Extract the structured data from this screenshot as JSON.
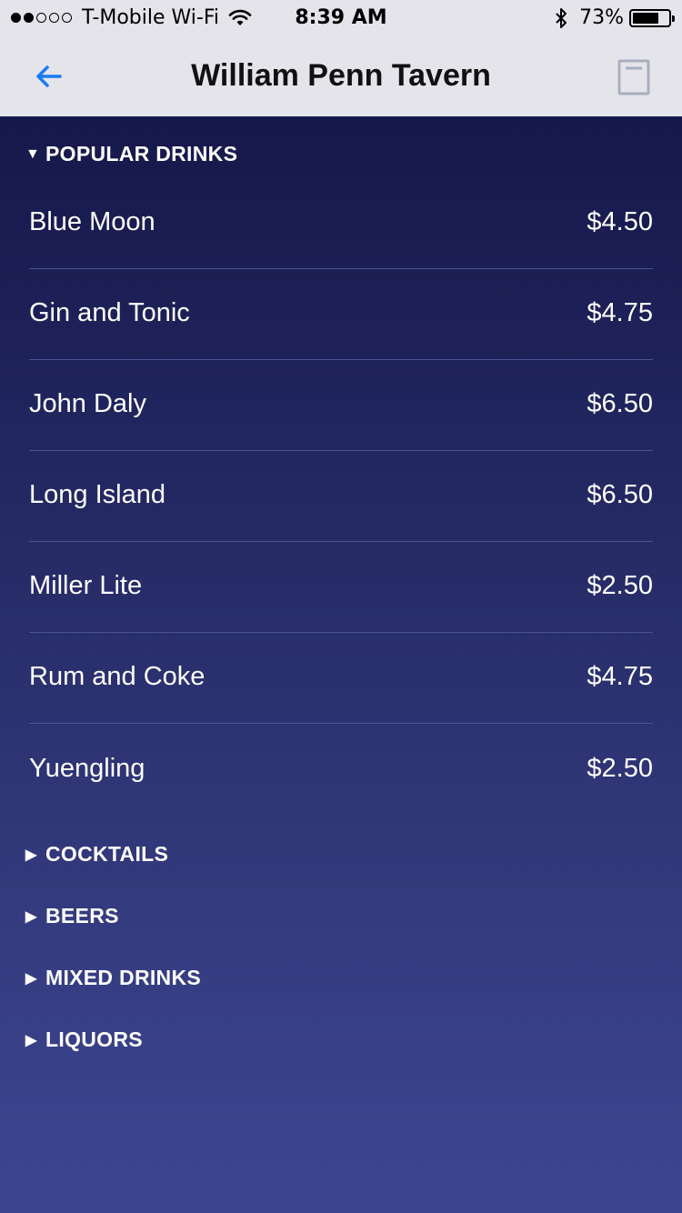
{
  "status_bar": {
    "carrier": "T-Mobile Wi-Fi",
    "time": "8:39 AM",
    "battery_percent": "73%",
    "battery_level": 0.73,
    "signal_bars_filled": 2,
    "signal_bars_total": 5
  },
  "nav": {
    "title": "William Penn Tavern",
    "back_icon": "arrow-left-icon",
    "right_icon": "tab-icon",
    "accent_color": "#1a7bf2"
  },
  "sections": {
    "popular": {
      "title": "POPULAR DRINKS",
      "expanded": true,
      "items": [
        {
          "name": "Blue Moon",
          "price": "$4.50"
        },
        {
          "name": "Gin and Tonic",
          "price": "$4.75"
        },
        {
          "name": "John Daly",
          "price": "$6.50"
        },
        {
          "name": "Long Island",
          "price": "$6.50"
        },
        {
          "name": "Miller Lite",
          "price": "$2.50"
        },
        {
          "name": "Rum and Coke",
          "price": "$4.75"
        },
        {
          "name": "Yuengling",
          "price": "$2.50"
        }
      ]
    },
    "cocktails": {
      "title": "COCKTAILS",
      "expanded": false
    },
    "beers": {
      "title": "BEERS",
      "expanded": false
    },
    "mixed_drinks": {
      "title": "MIXED DRINKS",
      "expanded": false
    },
    "liquors": {
      "title": "LIQUORS",
      "expanded": false
    }
  }
}
